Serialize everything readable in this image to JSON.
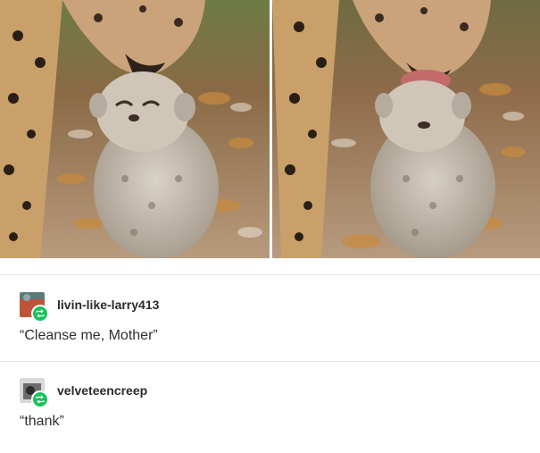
{
  "images": [
    {
      "alt": "",
      "icon": "cheetah-cub-photo"
    },
    {
      "alt": "",
      "icon": "cheetah-cub-lick-photo"
    }
  ],
  "reblogs": [
    {
      "username": "livin-like-larry413",
      "text": "“Cleanse me, Mother”",
      "avatar_color": "#c0523a"
    },
    {
      "username": "velveteencreep",
      "text": "“thank”",
      "avatar_color": "#6b6b6b"
    }
  ],
  "colors": {
    "reblog_badge": "#16c25a",
    "divider": "#e3e3e3"
  }
}
